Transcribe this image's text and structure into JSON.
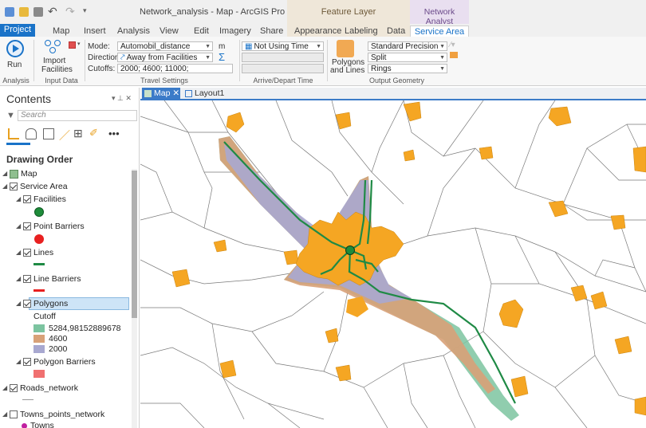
{
  "app": {
    "title": "Network_analysis - Map - ArcGIS Pro",
    "context_tab_feature": "Feature Layer",
    "context_tab_network": "Network Analyst"
  },
  "tabs": [
    "Project",
    "Map",
    "Insert",
    "Analysis",
    "View",
    "Edit",
    "Imagery",
    "Share",
    "Appearance",
    "Labeling",
    "Data",
    "Service Area"
  ],
  "ribbon": {
    "run": "Run",
    "import": "Import",
    "facilities": "Facilities",
    "analysis_group": "Analysis",
    "input_data_group": "Input Data",
    "mode_label": "Mode:",
    "mode_value": "Automobil_distance",
    "unit": "m",
    "direction_label": "Direction:",
    "direction_value": "Away from Facilities",
    "cutoffs_label": "Cutoffs:",
    "cutoffs_value": "2000; 4600; 11000;",
    "travel_group": "Travel Settings",
    "time_value": "Not Using Time",
    "arrive_group": "Arrive/Depart Time",
    "polygons_btn_1": "Polygons",
    "polygons_btn_2": "and Lines",
    "precision": "Standard Precision",
    "split": "Split",
    "rings": "Rings",
    "output_group": "Output Geometry"
  },
  "contents": {
    "title": "Contents",
    "search_placeholder": "Search",
    "drawing_order": "Drawing Order",
    "map": "Map",
    "service_area": "Service Area",
    "facilities": "Facilities",
    "point_barriers": "Point Barriers",
    "lines": "Lines",
    "line_barriers": "Line Barriers",
    "polygons": "Polygons",
    "cutoff": "Cutoff",
    "legend": [
      "5284,98152889678",
      "4600",
      "2000"
    ],
    "polygon_barriers": "Polygon Barriers",
    "roads": "Roads_network",
    "towns": "Towns_points_network",
    "towns_sub": "Towns"
  },
  "view_tabs": {
    "map": "Map",
    "layout": "Layout1"
  },
  "colors": {
    "town": "#f5a623",
    "facility": "#1e8c3a",
    "barrier": "#e82020",
    "line": "#1f8a45",
    "poly_outer": "#7cc4a0",
    "poly_mid": "#d8a178",
    "poly_inner": "#a8a8d0",
    "accent": "#1a73c8"
  }
}
